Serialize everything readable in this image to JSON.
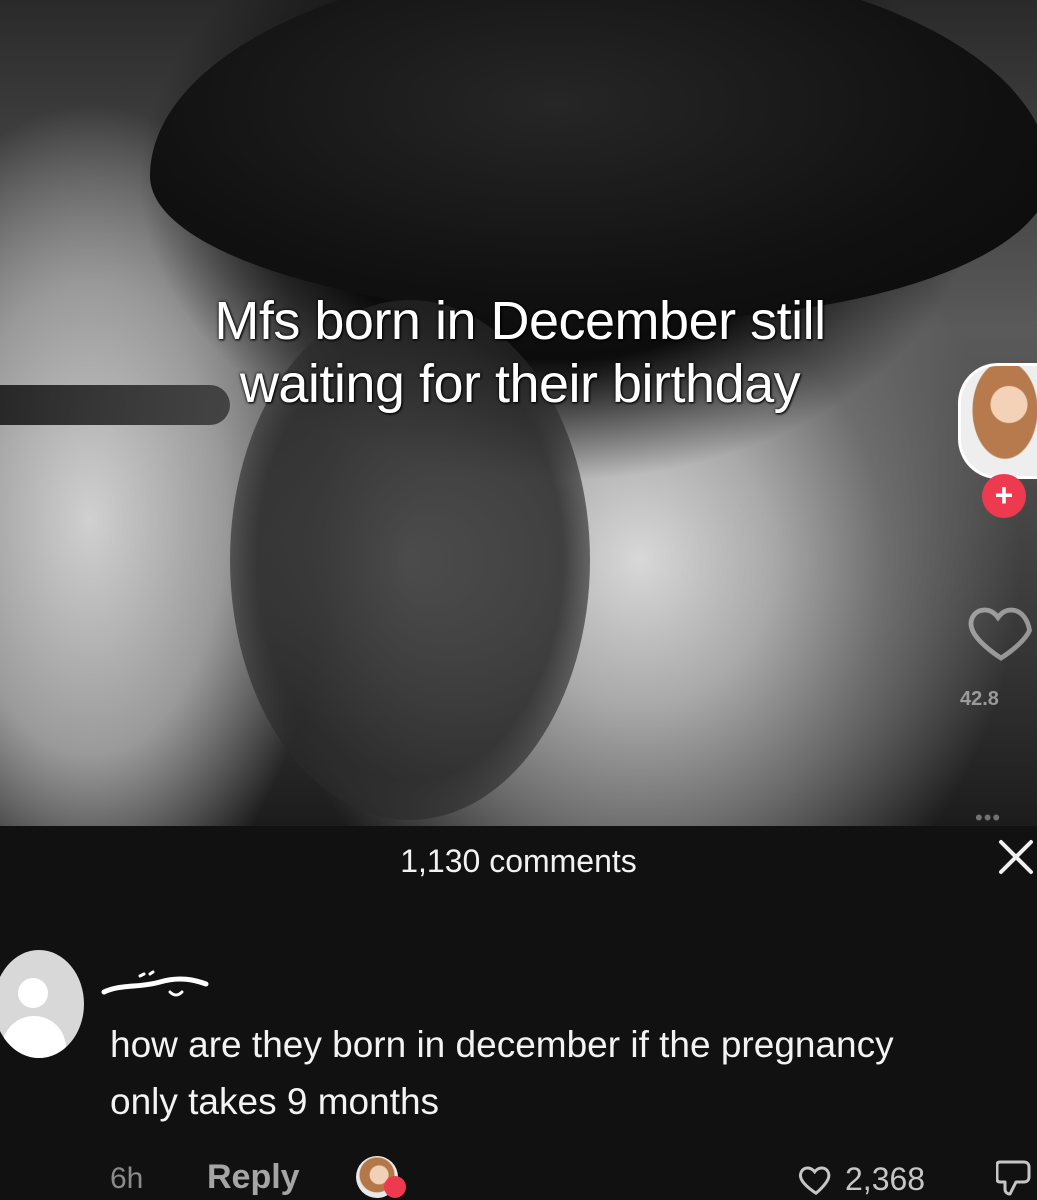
{
  "video": {
    "caption": "Mfs born in December still waiting for their birthday",
    "likes_count": "42.8",
    "more_dots": "•••"
  },
  "sheet": {
    "comments_count": "1,130 comments",
    "close_icon": "close-icon"
  },
  "comment": {
    "text": "how are they born in december if the pregnancy only takes 9 months",
    "timestamp": "6h",
    "reply_label": "Reply",
    "likes": "2,368"
  },
  "colors": {
    "follow_red": "#ee3a4e",
    "sheet_bg": "#111111",
    "text_primary": "#f3f3f3",
    "text_muted": "#8a8a8a"
  }
}
